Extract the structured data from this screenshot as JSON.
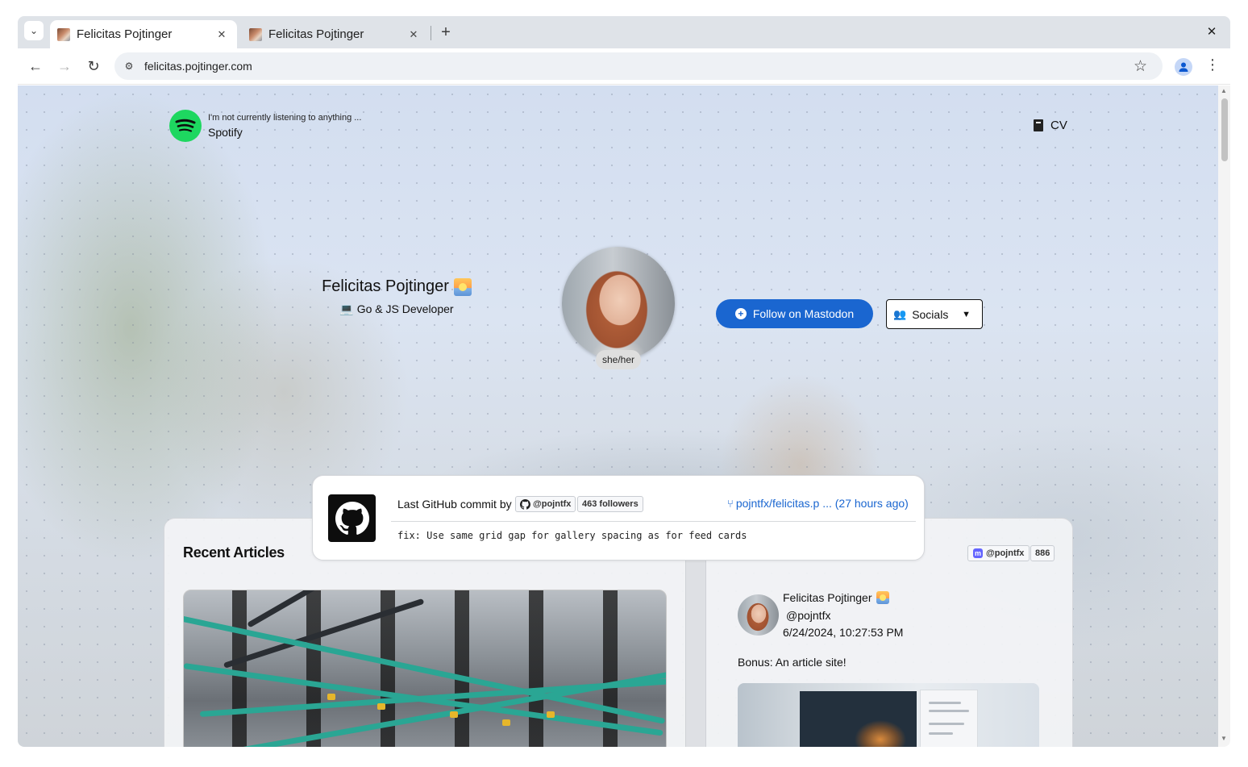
{
  "browser": {
    "tabs": [
      {
        "title": "Felicitas Pojtinger",
        "active": true
      },
      {
        "title": "Felicitas Pojtinger",
        "active": false
      }
    ],
    "url": "felicitas.pojtinger.com",
    "icons": {
      "tab_search": "chevron-down-icon",
      "tab_close": "close-icon",
      "new_tab": "plus-icon",
      "window_close": "close-icon",
      "back": "arrow-left-icon",
      "forward": "arrow-right-icon",
      "reload": "reload-icon",
      "site_info": "tune-icon",
      "bookmark": "star-icon",
      "profile": "person-icon",
      "menu": "kebab-icon"
    },
    "glyphs": {
      "tab_search": "⌄",
      "close": "✕",
      "new_tab": "+",
      "back": "←",
      "forward": "→",
      "reload": "↻",
      "site_info": "⚙",
      "star": "☆",
      "menu": "⋮",
      "scroll_up": "▲",
      "scroll_down": "▼"
    }
  },
  "page": {
    "spotify": {
      "status": "I'm not currently listening to anything ...",
      "label": "Spotify",
      "color": "#1ed760"
    },
    "cv": {
      "label": "CV"
    },
    "profile": {
      "name": "Felicitas Pojtinger",
      "role_emoji": "💻",
      "role": "Go & JS Developer",
      "pronouns": "she/her"
    },
    "follow_button": {
      "label": "Follow on Mastodon",
      "icon": "plus-circle-icon",
      "glyph": "+",
      "color": "#1a66d0"
    },
    "socials_button": {
      "label": "Socials",
      "icon": "users-icon",
      "glyph": "👥",
      "caret": "▼"
    },
    "github": {
      "heading": "Last GitHub commit by",
      "handle": "@pojntfx",
      "followers": "463 followers",
      "repo": "pojntfx/felicitas.p ... (27 hours ago)",
      "branch_glyph": "⑂",
      "message": "fix: Use same grid gap for gallery spacing as for feed cards"
    },
    "articles": {
      "title": "Recent Articles"
    },
    "mastodon": {
      "handle": "@pojntfx",
      "count": "886",
      "icon_glyph": "m",
      "post": {
        "author": "Felicitas Pojtinger",
        "handle": "@pojntfx",
        "time": "6/24/2024, 10:27:53 PM",
        "text": "Bonus: An article site!"
      }
    }
  }
}
